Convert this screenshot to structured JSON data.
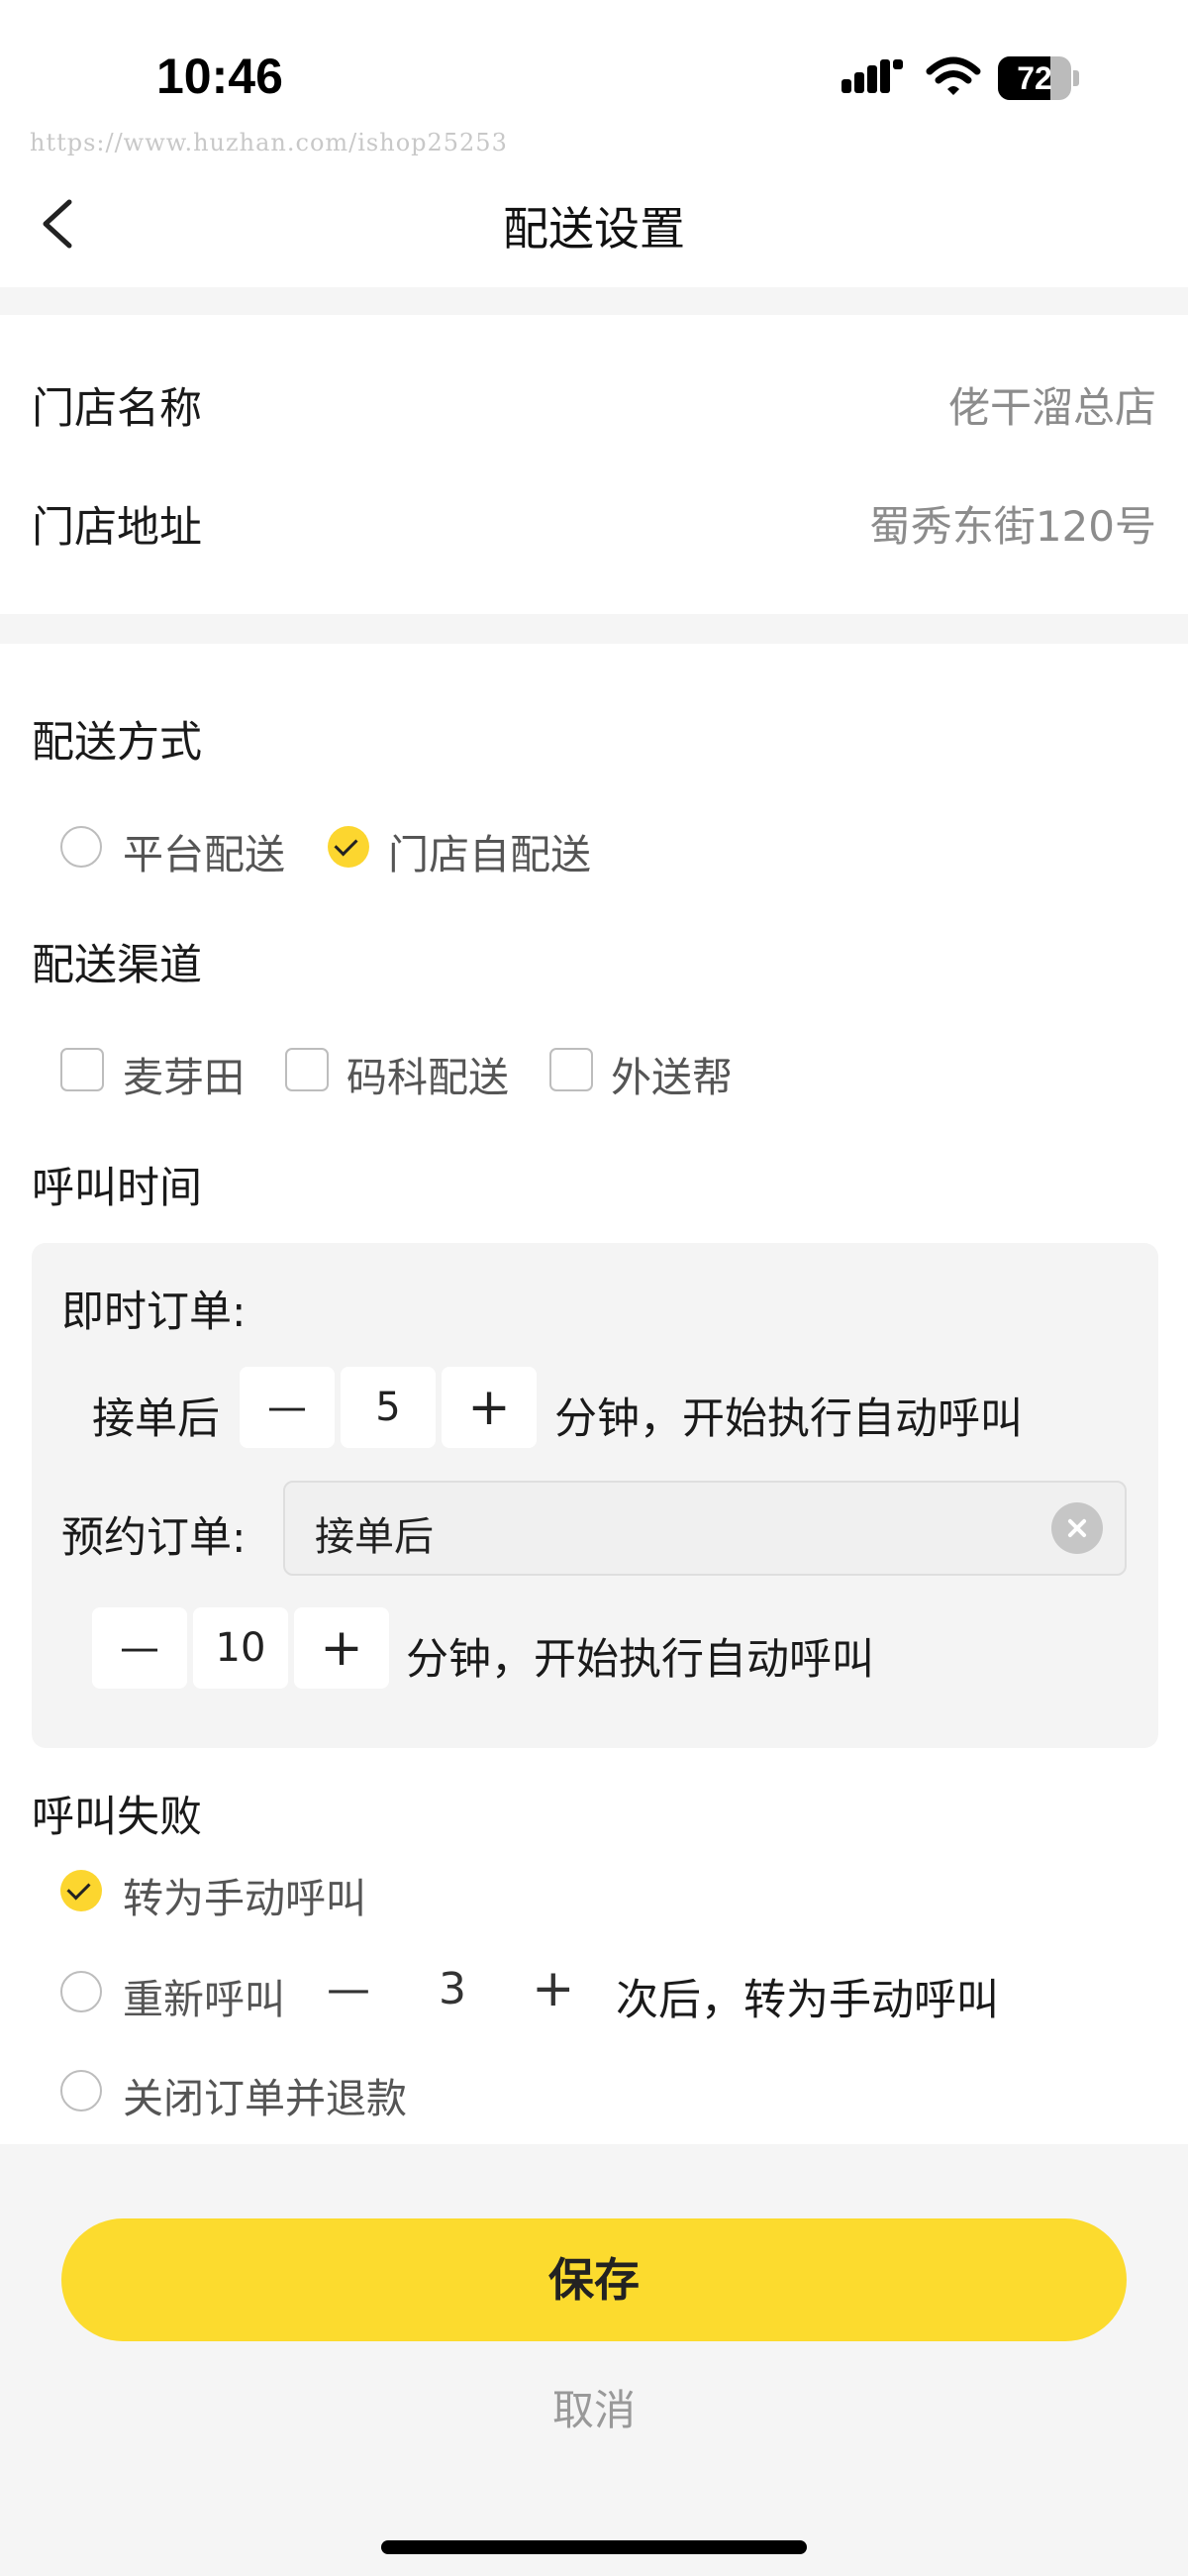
{
  "status_bar": {
    "time": "10:46",
    "battery": "72"
  },
  "watermark": "https://www.huzhan.com/ishop25253",
  "nav": {
    "title": "配送设置"
  },
  "store": {
    "name_label": "门店名称",
    "name_value": "佬干溜总店",
    "address_label": "门店地址",
    "address_value": "蜀秀东街120号"
  },
  "delivery": {
    "method_title": "配送方式",
    "methods": [
      {
        "label": "平台配送",
        "selected": false
      },
      {
        "label": "门店自配送",
        "selected": true
      }
    ],
    "channel_title": "配送渠道",
    "channels": [
      {
        "label": "麦芽田",
        "checked": false
      },
      {
        "label": "码科配送",
        "checked": false
      },
      {
        "label": "外送帮",
        "checked": false
      }
    ]
  },
  "call_time": {
    "title": "呼叫时间",
    "instant_label": "即时订单:",
    "instant_prefix": "接单后",
    "instant_minus": "—",
    "instant_value": "5",
    "instant_plus": "+",
    "instant_suffix": "分钟，开始执行自动呼叫",
    "reserve_label": "预约订单:",
    "reserve_select": "接单后",
    "reserve_minus": "—",
    "reserve_value": "10",
    "reserve_plus": "+",
    "reserve_suffix": "分钟，开始执行自动呼叫"
  },
  "call_fail": {
    "title": "呼叫失败",
    "opt1": "转为手动呼叫",
    "opt2_prefix": "重新呼叫",
    "opt2_minus": "—",
    "opt2_value": "3",
    "opt2_plus": "+",
    "opt2_suffix": "次后，转为手动呼叫",
    "opt3": "关闭订单并退款",
    "selected_index": 0
  },
  "actions": {
    "save": "保存",
    "cancel": "取消"
  },
  "colors": {
    "accent": "#fcdb2e",
    "background": "#f5f5f5"
  }
}
